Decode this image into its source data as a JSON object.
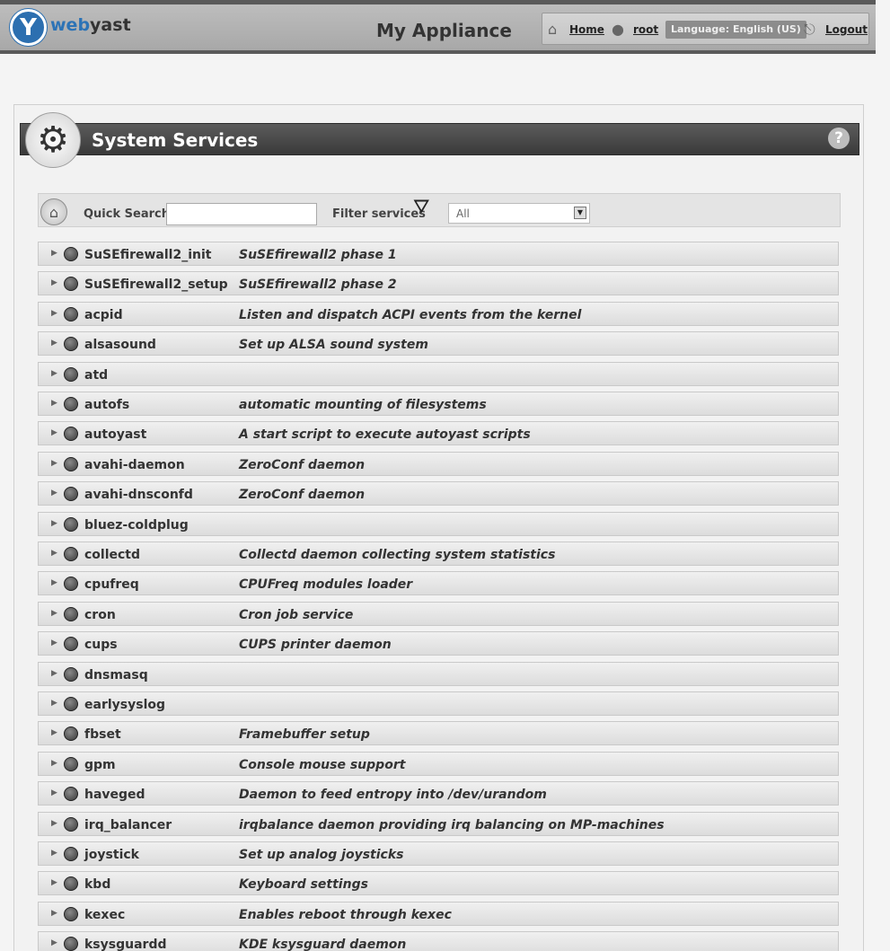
{
  "header": {
    "brand_web": "web",
    "brand_yast": "yast",
    "app_title": "My Appliance",
    "nav": {
      "home": "Home",
      "user": "root",
      "language": "Language: English (US)",
      "logout": "Logout"
    }
  },
  "panel": {
    "title": "System Services",
    "help": "?"
  },
  "filterbar": {
    "quick_search_label": "Quick Search",
    "search_value": "",
    "filter_label": "Filter services",
    "filter_selected": "All"
  },
  "services": [
    {
      "name": "SuSEfirewall2_init",
      "desc": "SuSEfirewall2 phase 1"
    },
    {
      "name": "SuSEfirewall2_setup",
      "desc": "SuSEfirewall2 phase 2"
    },
    {
      "name": "acpid",
      "desc": "Listen and dispatch ACPI events from the kernel"
    },
    {
      "name": "alsasound",
      "desc": "Set up ALSA sound system"
    },
    {
      "name": "atd",
      "desc": ""
    },
    {
      "name": "autofs",
      "desc": "automatic mounting of filesystems"
    },
    {
      "name": "autoyast",
      "desc": "A start script to execute autoyast scripts"
    },
    {
      "name": "avahi-daemon",
      "desc": "ZeroConf daemon"
    },
    {
      "name": "avahi-dnsconfd",
      "desc": "ZeroConf daemon"
    },
    {
      "name": "bluez-coldplug",
      "desc": ""
    },
    {
      "name": "collectd",
      "desc": "Collectd daemon collecting system statistics"
    },
    {
      "name": "cpufreq",
      "desc": "CPUFreq modules loader"
    },
    {
      "name": "cron",
      "desc": "Cron job service"
    },
    {
      "name": "cups",
      "desc": "CUPS printer daemon"
    },
    {
      "name": "dnsmasq",
      "desc": ""
    },
    {
      "name": "earlysyslog",
      "desc": ""
    },
    {
      "name": "fbset",
      "desc": "Framebuffer setup"
    },
    {
      "name": "gpm",
      "desc": "Console mouse support"
    },
    {
      "name": "haveged",
      "desc": "Daemon to feed entropy into /dev/urandom"
    },
    {
      "name": "irq_balancer",
      "desc": "irqbalance daemon providing irq balancing on MP-machines"
    },
    {
      "name": "joystick",
      "desc": "Set up analog joysticks"
    },
    {
      "name": "kbd",
      "desc": "Keyboard settings"
    },
    {
      "name": "kexec",
      "desc": "Enables reboot through kexec"
    },
    {
      "name": "ksysguardd",
      "desc": "KDE ksysguard daemon"
    }
  ]
}
